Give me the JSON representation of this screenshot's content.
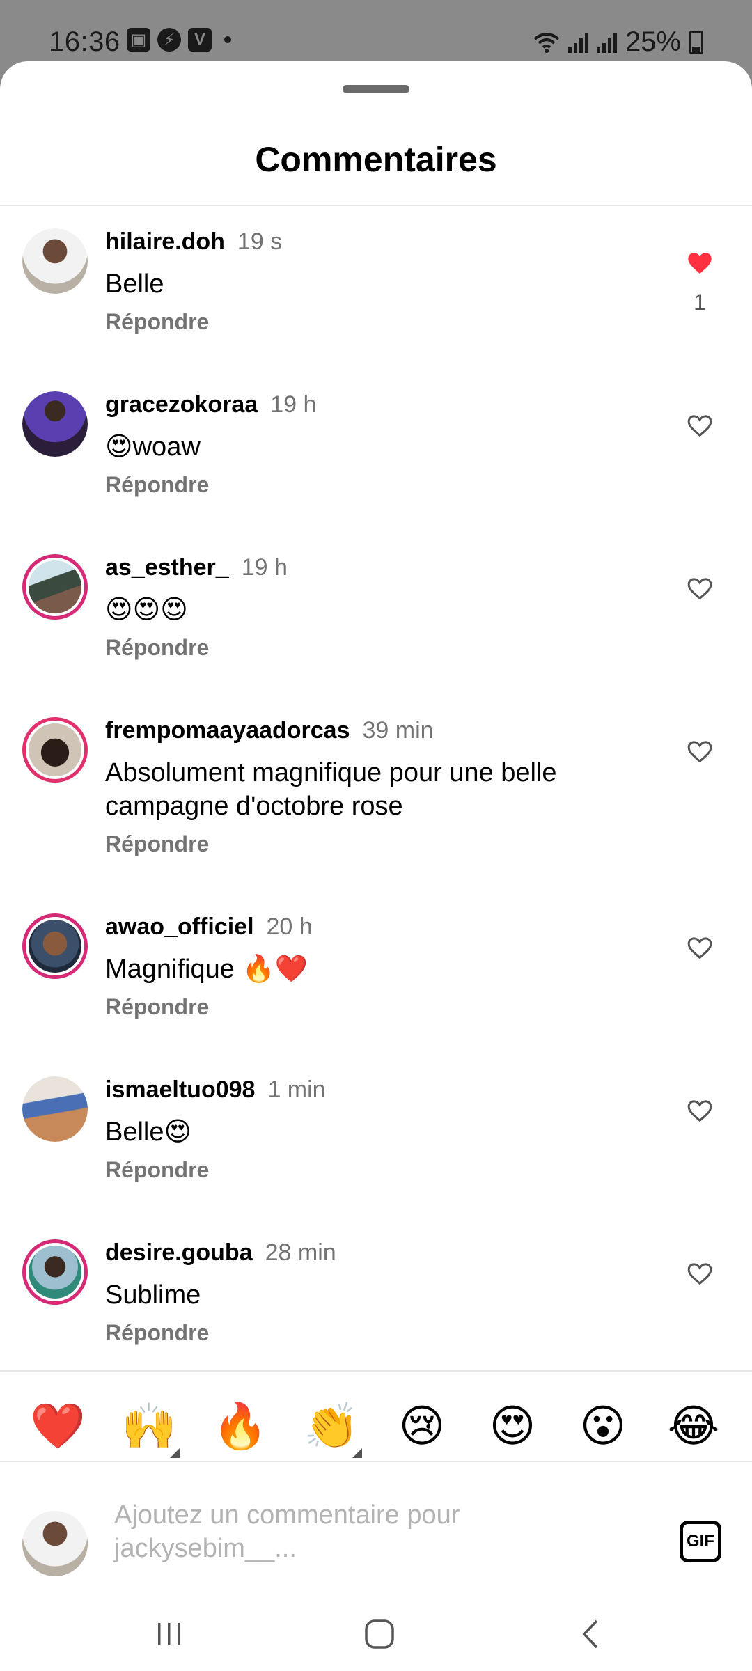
{
  "status_bar": {
    "time": "16:36",
    "battery": "25%",
    "icons": [
      "gallery-icon",
      "messenger-icon",
      "v-app-icon",
      "dot-icon",
      "wifi-icon",
      "signal-icon",
      "signal-icon",
      "battery-icon"
    ]
  },
  "sheet": {
    "title": "Commentaires"
  },
  "comments": [
    {
      "user": "hilaire.doh",
      "time": "19 s",
      "text": "Belle",
      "reply": "Répondre",
      "liked": true,
      "likes": "1"
    },
    {
      "user": "gracezokoraa",
      "time": "19 h",
      "text": "😍woaw",
      "reply": "Répondre",
      "liked": false
    },
    {
      "user": "as_esther_",
      "time": "19 h",
      "text": "😍😍😍",
      "reply": "Répondre",
      "liked": false
    },
    {
      "user": "frempomaayaadorcas",
      "time": "39 min",
      "text": "Absolument magnifique pour une belle campagne d'octobre rose",
      "reply": "Répondre",
      "liked": false
    },
    {
      "user": "awao_officiel",
      "time": "20 h",
      "text": "Magnifique 🔥❤️",
      "reply": "Répondre",
      "liked": false
    },
    {
      "user": "ismaeltuo098",
      "time": "1 min",
      "text": "Belle😍",
      "reply": "Répondre",
      "liked": false
    },
    {
      "user": "desire.gouba",
      "time": "28 min",
      "text": "Sublime",
      "reply": "Répondre",
      "liked": false
    }
  ],
  "quick_reactions": [
    "❤️",
    "🙌",
    "🔥",
    "👏",
    "😢",
    "😍",
    "😮",
    "😂"
  ],
  "composer": {
    "placeholder": "Ajoutez un commentaire pour jackysebim__...",
    "gif_label": "GIF"
  },
  "colors": {
    "like_red": "#ff3040",
    "story_ring": "#d62976",
    "muted_text": "#737373"
  }
}
